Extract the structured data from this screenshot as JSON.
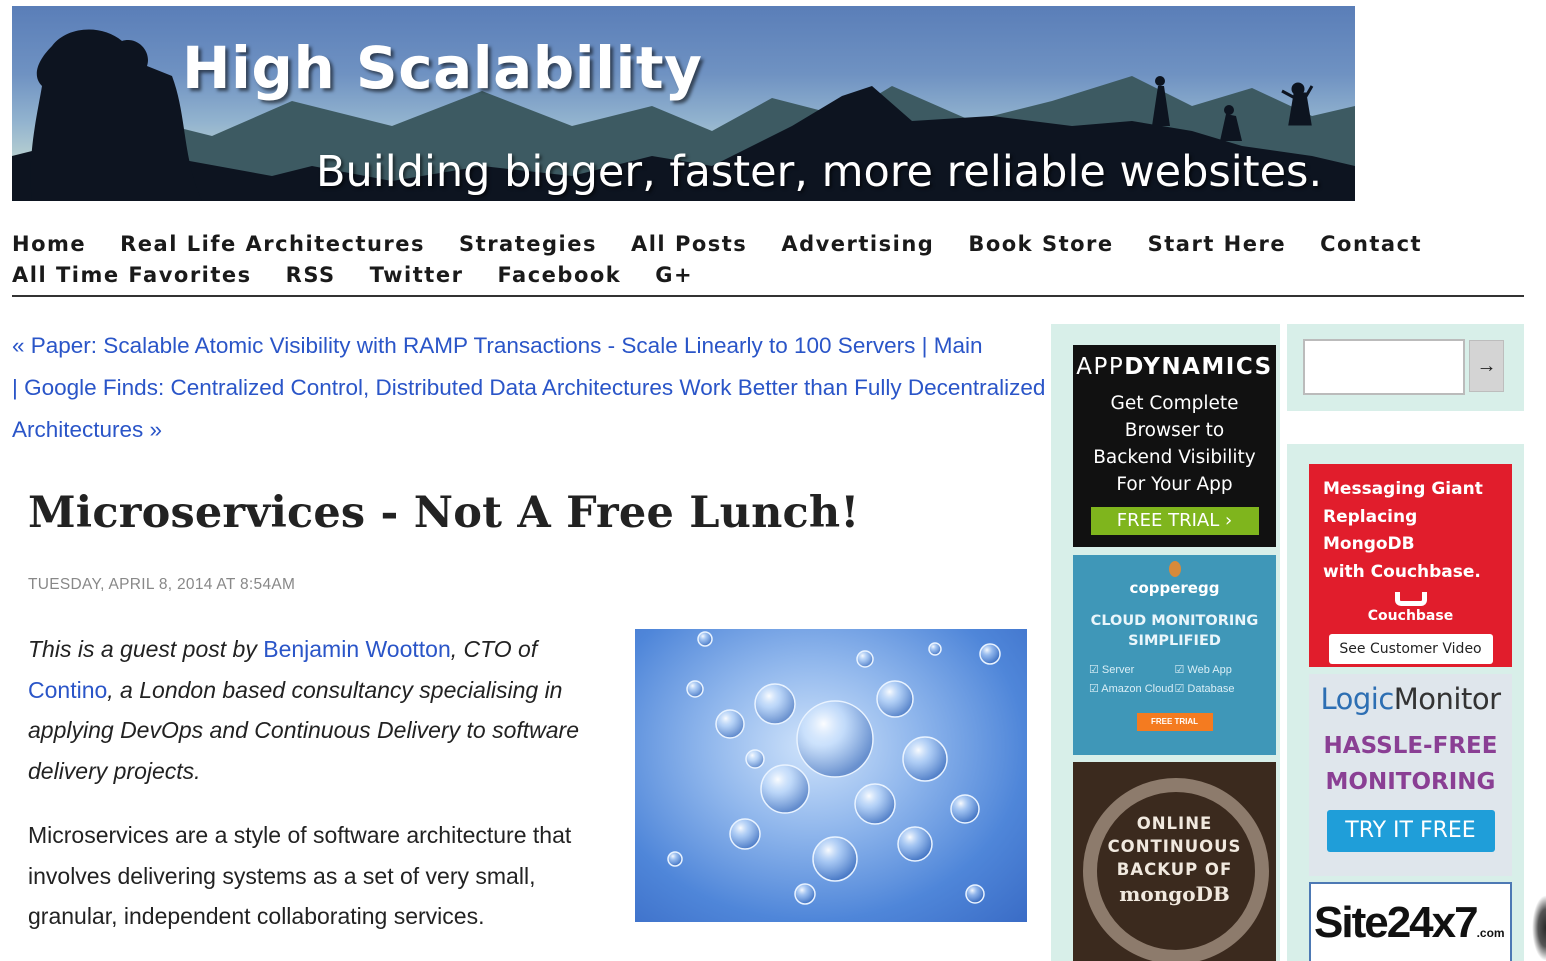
{
  "banner": {
    "title": "High Scalability",
    "tagline": "Building bigger, faster, more reliable websites."
  },
  "nav": {
    "row1": [
      "Home",
      "Real Life Architectures",
      "Strategies",
      "All Posts",
      "Advertising",
      "Book Store",
      "Start Here",
      "Contact"
    ],
    "row2": [
      "All Time Favorites",
      "RSS",
      "Twitter",
      "Facebook",
      "G+"
    ]
  },
  "postnav": {
    "prev_label": "« Paper: Scalable Atomic Visibility with RAMP Transactions - Scale Linearly to 100 Servers",
    "separator": "|",
    "main_label": "Main",
    "next_label": "Google Finds: Centralized Control, Distributed Data Architectures Work Better than Fully Decentralized Architectures »"
  },
  "post": {
    "title": "Microservices - Not A Free Lunch!",
    "date": "TUESDAY, APRIL 8, 2014 AT 8:54AM",
    "intro_1": "This is a guest post by ",
    "author_link": "Benjamin Wootton",
    "intro_2": ", CTO of ",
    "company_link": "Contino",
    "intro_3": ", a London based consultancy specialising in applying DevOps and Continuous Delivery to software delivery projects.",
    "paragraph_2": "Microservices are a style of software architecture that involves delivering systems as a set of very small, granular, independent collaborating services."
  },
  "search": {
    "placeholder": "",
    "button_label": "→"
  },
  "ads": {
    "appdynamics": {
      "brand_light": "APP",
      "brand_bold": "DYNAMICS",
      "lines": [
        "Get Complete",
        "Browser to",
        "Backend Visibility",
        "For Your App"
      ],
      "cta": "FREE TRIAL ›"
    },
    "copperegg": {
      "brand": "copperegg",
      "headline_1": "CLOUD MONITORING",
      "headline_2": "SIMPLIFIED",
      "features": [
        "☑ Server",
        "☑ Web App",
        "☑ Amazon Cloud",
        "☑ Database"
      ],
      "cta": "FREE TRIAL"
    },
    "mongo_backup": {
      "line1": "ONLINE",
      "line2": "CONTINUOUS",
      "line3": "BACKUP OF",
      "brand": "mongoDB"
    },
    "couchbase": {
      "headline_1": "Messaging Giant",
      "headline_2": "Replacing MongoDB",
      "headline_3": "with Couchbase.",
      "brand": "Couchbase",
      "cta": "See Customer Video"
    },
    "logicmonitor": {
      "brand_a": "Logic",
      "brand_b": "Monitor",
      "headline_1": "HASSLE-FREE",
      "headline_2": "MONITORING",
      "cta": "TRY IT FREE"
    },
    "site24x7": {
      "brand": "Site24x7",
      "suffix": ".com"
    }
  },
  "colors": {
    "link": "#2a55c8",
    "ad_background": "#d8efe9",
    "appdynamics_green": "#7fb51d",
    "couchbase_red": "#e11d2c",
    "logicmonitor_purple": "#8a3f94",
    "logicmonitor_blue": "#1f9ed9"
  }
}
